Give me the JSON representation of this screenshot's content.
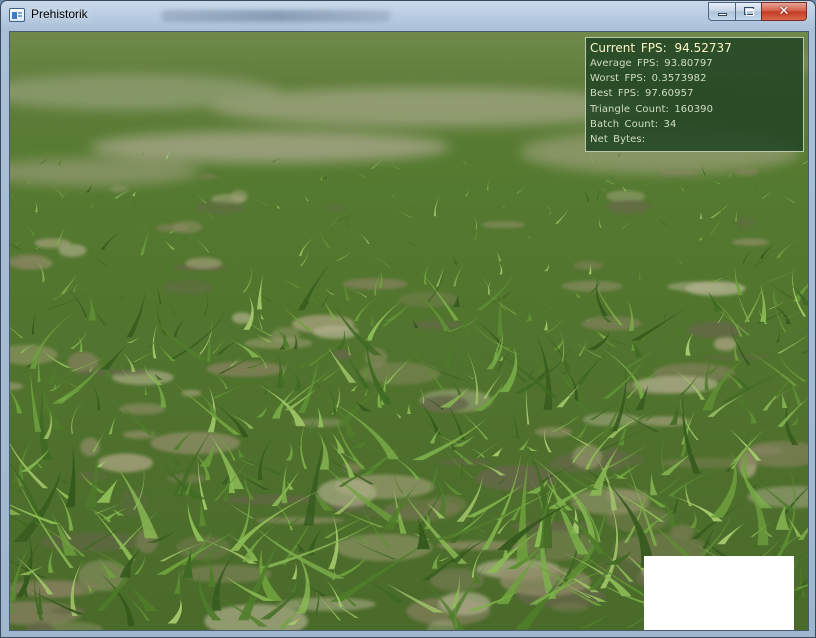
{
  "window": {
    "title": "Prehistorik",
    "buttons": {
      "minimize": "minimize-icon",
      "maximize": "maximize-icon",
      "close": "close-icon",
      "close_glyph": "✕"
    }
  },
  "stats": {
    "current_label": "Current FPS:",
    "current_value": "94.52737",
    "lines": [
      {
        "label": "Average FPS:",
        "value": "93.80797"
      },
      {
        "label": "Worst FPS:",
        "value": "0.3573982"
      },
      {
        "label": "Best FPS:",
        "value": "97.60957"
      },
      {
        "label": "Triangle Count:",
        "value": "160390"
      },
      {
        "label": "Batch Count:",
        "value": "34"
      },
      {
        "label": "Net Bytes:",
        "value": ""
      }
    ]
  },
  "scene": {
    "description_colors": {
      "grass_dark": "#3e5e26",
      "grass_light": "#8fb05a",
      "soil": "#b9ab8c"
    }
  }
}
